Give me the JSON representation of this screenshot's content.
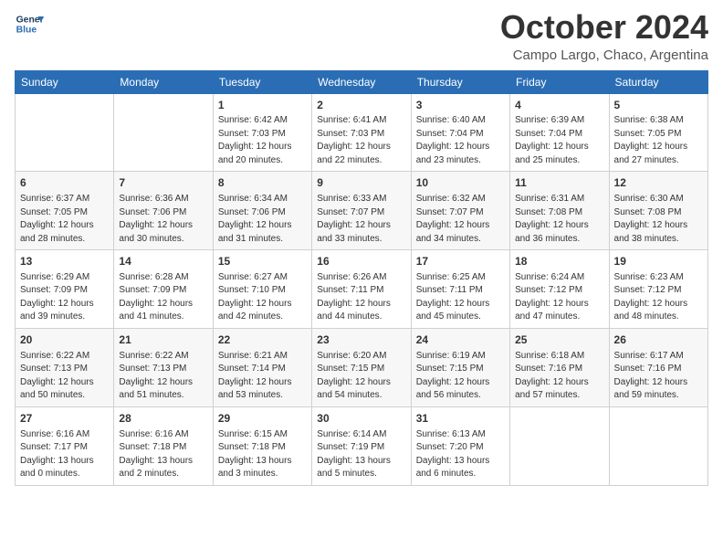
{
  "header": {
    "logo_line1": "General",
    "logo_line2": "Blue",
    "month": "October 2024",
    "location": "Campo Largo, Chaco, Argentina"
  },
  "days_of_week": [
    "Sunday",
    "Monday",
    "Tuesday",
    "Wednesday",
    "Thursday",
    "Friday",
    "Saturday"
  ],
  "weeks": [
    [
      {
        "day": "",
        "info": ""
      },
      {
        "day": "",
        "info": ""
      },
      {
        "day": "1",
        "info": "Sunrise: 6:42 AM\nSunset: 7:03 PM\nDaylight: 12 hours\nand 20 minutes."
      },
      {
        "day": "2",
        "info": "Sunrise: 6:41 AM\nSunset: 7:03 PM\nDaylight: 12 hours\nand 22 minutes."
      },
      {
        "day": "3",
        "info": "Sunrise: 6:40 AM\nSunset: 7:04 PM\nDaylight: 12 hours\nand 23 minutes."
      },
      {
        "day": "4",
        "info": "Sunrise: 6:39 AM\nSunset: 7:04 PM\nDaylight: 12 hours\nand 25 minutes."
      },
      {
        "day": "5",
        "info": "Sunrise: 6:38 AM\nSunset: 7:05 PM\nDaylight: 12 hours\nand 27 minutes."
      }
    ],
    [
      {
        "day": "6",
        "info": "Sunrise: 6:37 AM\nSunset: 7:05 PM\nDaylight: 12 hours\nand 28 minutes."
      },
      {
        "day": "7",
        "info": "Sunrise: 6:36 AM\nSunset: 7:06 PM\nDaylight: 12 hours\nand 30 minutes."
      },
      {
        "day": "8",
        "info": "Sunrise: 6:34 AM\nSunset: 7:06 PM\nDaylight: 12 hours\nand 31 minutes."
      },
      {
        "day": "9",
        "info": "Sunrise: 6:33 AM\nSunset: 7:07 PM\nDaylight: 12 hours\nand 33 minutes."
      },
      {
        "day": "10",
        "info": "Sunrise: 6:32 AM\nSunset: 7:07 PM\nDaylight: 12 hours\nand 34 minutes."
      },
      {
        "day": "11",
        "info": "Sunrise: 6:31 AM\nSunset: 7:08 PM\nDaylight: 12 hours\nand 36 minutes."
      },
      {
        "day": "12",
        "info": "Sunrise: 6:30 AM\nSunset: 7:08 PM\nDaylight: 12 hours\nand 38 minutes."
      }
    ],
    [
      {
        "day": "13",
        "info": "Sunrise: 6:29 AM\nSunset: 7:09 PM\nDaylight: 12 hours\nand 39 minutes."
      },
      {
        "day": "14",
        "info": "Sunrise: 6:28 AM\nSunset: 7:09 PM\nDaylight: 12 hours\nand 41 minutes."
      },
      {
        "day": "15",
        "info": "Sunrise: 6:27 AM\nSunset: 7:10 PM\nDaylight: 12 hours\nand 42 minutes."
      },
      {
        "day": "16",
        "info": "Sunrise: 6:26 AM\nSunset: 7:11 PM\nDaylight: 12 hours\nand 44 minutes."
      },
      {
        "day": "17",
        "info": "Sunrise: 6:25 AM\nSunset: 7:11 PM\nDaylight: 12 hours\nand 45 minutes."
      },
      {
        "day": "18",
        "info": "Sunrise: 6:24 AM\nSunset: 7:12 PM\nDaylight: 12 hours\nand 47 minutes."
      },
      {
        "day": "19",
        "info": "Sunrise: 6:23 AM\nSunset: 7:12 PM\nDaylight: 12 hours\nand 48 minutes."
      }
    ],
    [
      {
        "day": "20",
        "info": "Sunrise: 6:22 AM\nSunset: 7:13 PM\nDaylight: 12 hours\nand 50 minutes."
      },
      {
        "day": "21",
        "info": "Sunrise: 6:22 AM\nSunset: 7:13 PM\nDaylight: 12 hours\nand 51 minutes."
      },
      {
        "day": "22",
        "info": "Sunrise: 6:21 AM\nSunset: 7:14 PM\nDaylight: 12 hours\nand 53 minutes."
      },
      {
        "day": "23",
        "info": "Sunrise: 6:20 AM\nSunset: 7:15 PM\nDaylight: 12 hours\nand 54 minutes."
      },
      {
        "day": "24",
        "info": "Sunrise: 6:19 AM\nSunset: 7:15 PM\nDaylight: 12 hours\nand 56 minutes."
      },
      {
        "day": "25",
        "info": "Sunrise: 6:18 AM\nSunset: 7:16 PM\nDaylight: 12 hours\nand 57 minutes."
      },
      {
        "day": "26",
        "info": "Sunrise: 6:17 AM\nSunset: 7:16 PM\nDaylight: 12 hours\nand 59 minutes."
      }
    ],
    [
      {
        "day": "27",
        "info": "Sunrise: 6:16 AM\nSunset: 7:17 PM\nDaylight: 13 hours\nand 0 minutes."
      },
      {
        "day": "28",
        "info": "Sunrise: 6:16 AM\nSunset: 7:18 PM\nDaylight: 13 hours\nand 2 minutes."
      },
      {
        "day": "29",
        "info": "Sunrise: 6:15 AM\nSunset: 7:18 PM\nDaylight: 13 hours\nand 3 minutes."
      },
      {
        "day": "30",
        "info": "Sunrise: 6:14 AM\nSunset: 7:19 PM\nDaylight: 13 hours\nand 5 minutes."
      },
      {
        "day": "31",
        "info": "Sunrise: 6:13 AM\nSunset: 7:20 PM\nDaylight: 13 hours\nand 6 minutes."
      },
      {
        "day": "",
        "info": ""
      },
      {
        "day": "",
        "info": ""
      }
    ]
  ]
}
